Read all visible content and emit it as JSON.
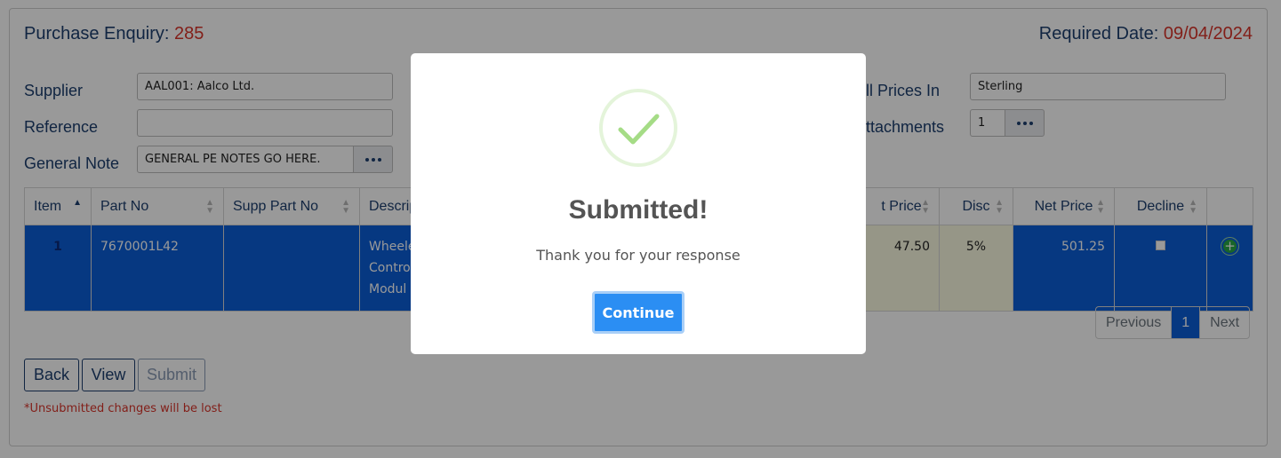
{
  "header": {
    "enquiry_label": "Purchase Enquiry:",
    "enquiry_number": "285",
    "required_label": "Required Date:",
    "required_date": "09/04/2024"
  },
  "form": {
    "supplier_label": "Supplier",
    "supplier_value": "AAL001: Aalco Ltd.",
    "reference_label": "Reference",
    "reference_value": "",
    "general_note_label": "General Note",
    "general_note_value": "GENERAL PE NOTES GO HERE.",
    "prices_label": "All Prices In",
    "prices_value": "Sterling",
    "attachments_label": "Attachments",
    "attachments_value": "1"
  },
  "table": {
    "columns": [
      "Item",
      "Part No",
      "Supp Part No",
      "Descrip",
      "t Price",
      "Disc",
      "Net Price",
      "Decline"
    ],
    "row": {
      "item": "1",
      "part_no": "7670001L42",
      "supp_part_no": "",
      "desc_line1": "Wheele",
      "desc_line2": "Contro",
      "desc_line3": "Modul",
      "unit_price": "47.50",
      "disc": "5%",
      "net_price": "501.25"
    }
  },
  "pager": {
    "previous": "Previous",
    "page": "1",
    "next": "Next"
  },
  "actions": {
    "back": "Back",
    "view": "View",
    "submit": "Submit",
    "warning": "*Unsubmitted changes will be lost"
  },
  "modal": {
    "title": "Submitted!",
    "text": "Thank you for your response",
    "continue": "Continue"
  },
  "colors": {
    "accent": "#0b5ed7",
    "header_value": "#d9342b",
    "success": "#a5dc86",
    "confirm": "#2b8ef3"
  }
}
